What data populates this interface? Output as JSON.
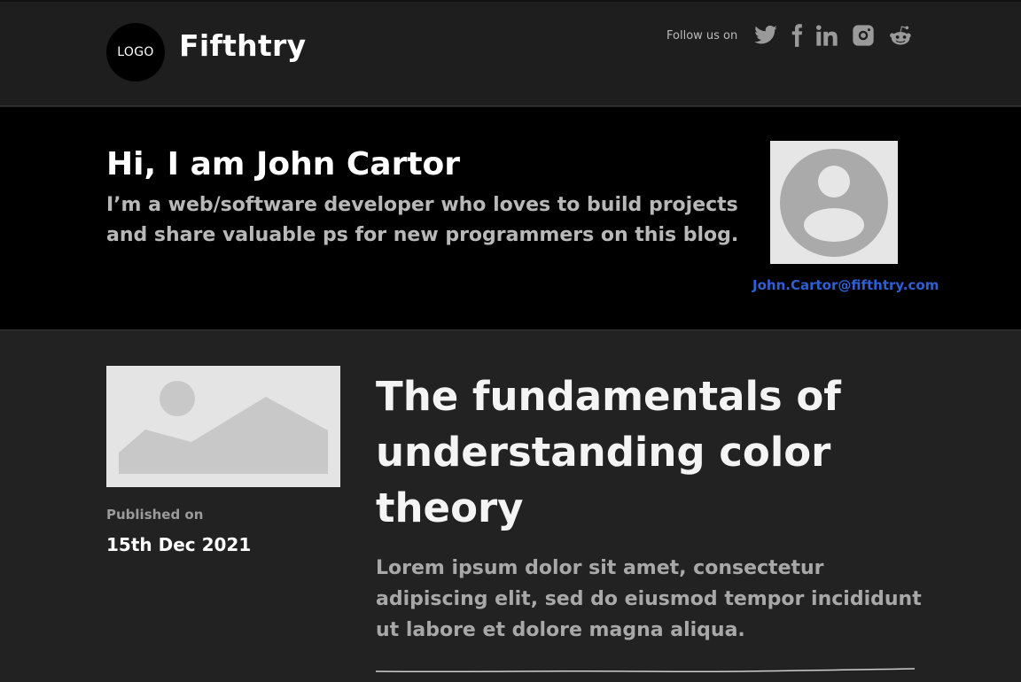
{
  "header": {
    "logo_text": "LOGO",
    "site_name": "Fifthtry",
    "follow_text": "Follow us on",
    "social": [
      {
        "name": "twitter-icon"
      },
      {
        "name": "facebook-icon"
      },
      {
        "name": "linkedin-icon"
      },
      {
        "name": "instagram-icon"
      },
      {
        "name": "reddit-icon"
      }
    ]
  },
  "hero": {
    "title": "Hi, I am John Cartor",
    "description": "I’m a web/software developer who loves to build projects and share valuable ps for new programmers on this blog.",
    "avatar_icon": "user-avatar-icon",
    "email": "John.Cartor@fifthtry.com"
  },
  "post": {
    "thumbnail_icon": "image-placeholder-icon",
    "published_label": "Published on",
    "published_date": "15th Dec 2021",
    "title": "The fundamentals of understanding color theory",
    "excerpt": "Lorem ipsum dolor sit amet, consectetur adipiscing elit, sed do eiusmod tempor incididunt ut labore et dolore magna aliqua."
  },
  "colors": {
    "background": "#222222",
    "header_bg": "#1e1e1e",
    "hero_bg": "#000000",
    "link": "#2f5fd0",
    "muted_text": "#a8a8a8"
  }
}
